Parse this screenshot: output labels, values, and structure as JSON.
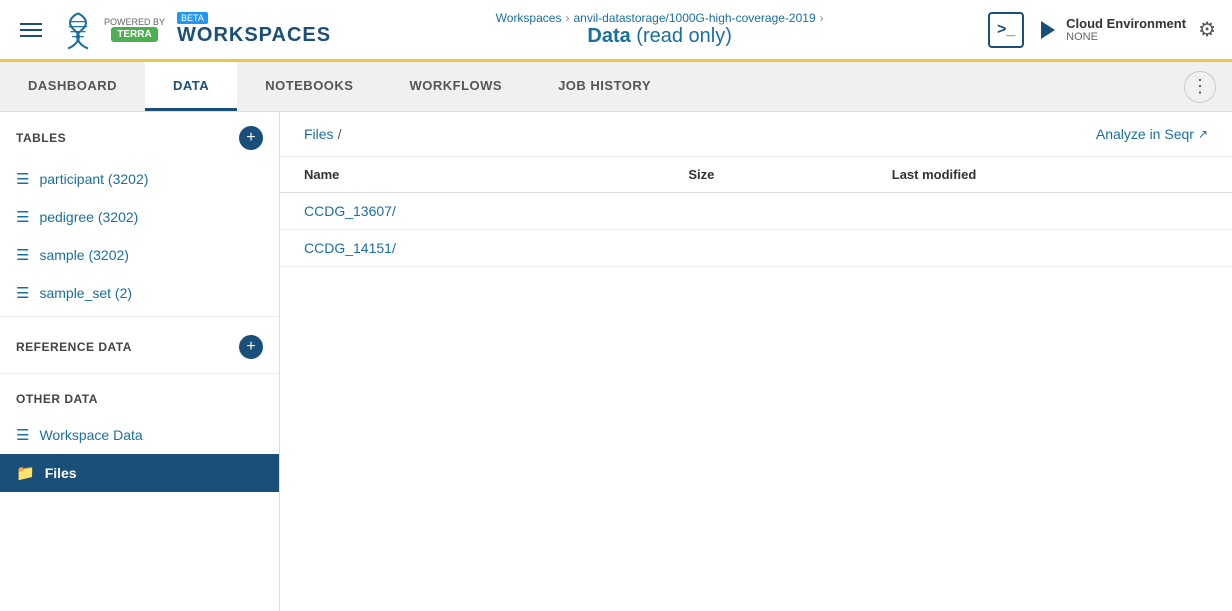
{
  "header": {
    "hamburger_label": "Menu",
    "powered_by": "POWERED BY",
    "terra": "TERRA",
    "beta": "BETA",
    "workspaces": "WORKSPACES",
    "breadcrumb": {
      "workspaces": "Workspaces",
      "workspace_name": "anvil-datastorage/1000G-high-coverage-2019",
      "sep1": "›",
      "sep2": "›"
    },
    "page_title": "Data",
    "page_subtitle": "(read only)",
    "terminal_icon": ">_",
    "cloud_env_label": "Cloud Environment",
    "cloud_env_status": "NONE",
    "gear_icon": "⚙"
  },
  "nav": {
    "tabs": [
      {
        "label": "DASHBOARD",
        "active": false
      },
      {
        "label": "DATA",
        "active": true
      },
      {
        "label": "NOTEBOOKS",
        "active": false
      },
      {
        "label": "WORKFLOWS",
        "active": false
      },
      {
        "label": "JOB HISTORY",
        "active": false
      }
    ],
    "more_icon": "⋮"
  },
  "sidebar": {
    "tables_section": "TABLES",
    "tables_items": [
      {
        "label": "participant (3202)"
      },
      {
        "label": "pedigree (3202)"
      },
      {
        "label": "sample (3202)"
      },
      {
        "label": "sample_set (2)"
      }
    ],
    "reference_data_section": "REFERENCE DATA",
    "other_data_section": "OTHER DATA",
    "other_data_items": [
      {
        "label": "Workspace Data",
        "active": false
      },
      {
        "label": "Files",
        "active": true
      }
    ]
  },
  "content": {
    "files_link": "Files",
    "breadcrumb_sep": "/",
    "analyze_label": "Analyze in Seqr",
    "table": {
      "headers": [
        "Name",
        "Size",
        "Last modified"
      ],
      "rows": [
        {
          "name": "CCDG_13607/",
          "size": "",
          "last_modified": ""
        },
        {
          "name": "CCDG_14151/",
          "size": "",
          "last_modified": ""
        }
      ]
    }
  }
}
